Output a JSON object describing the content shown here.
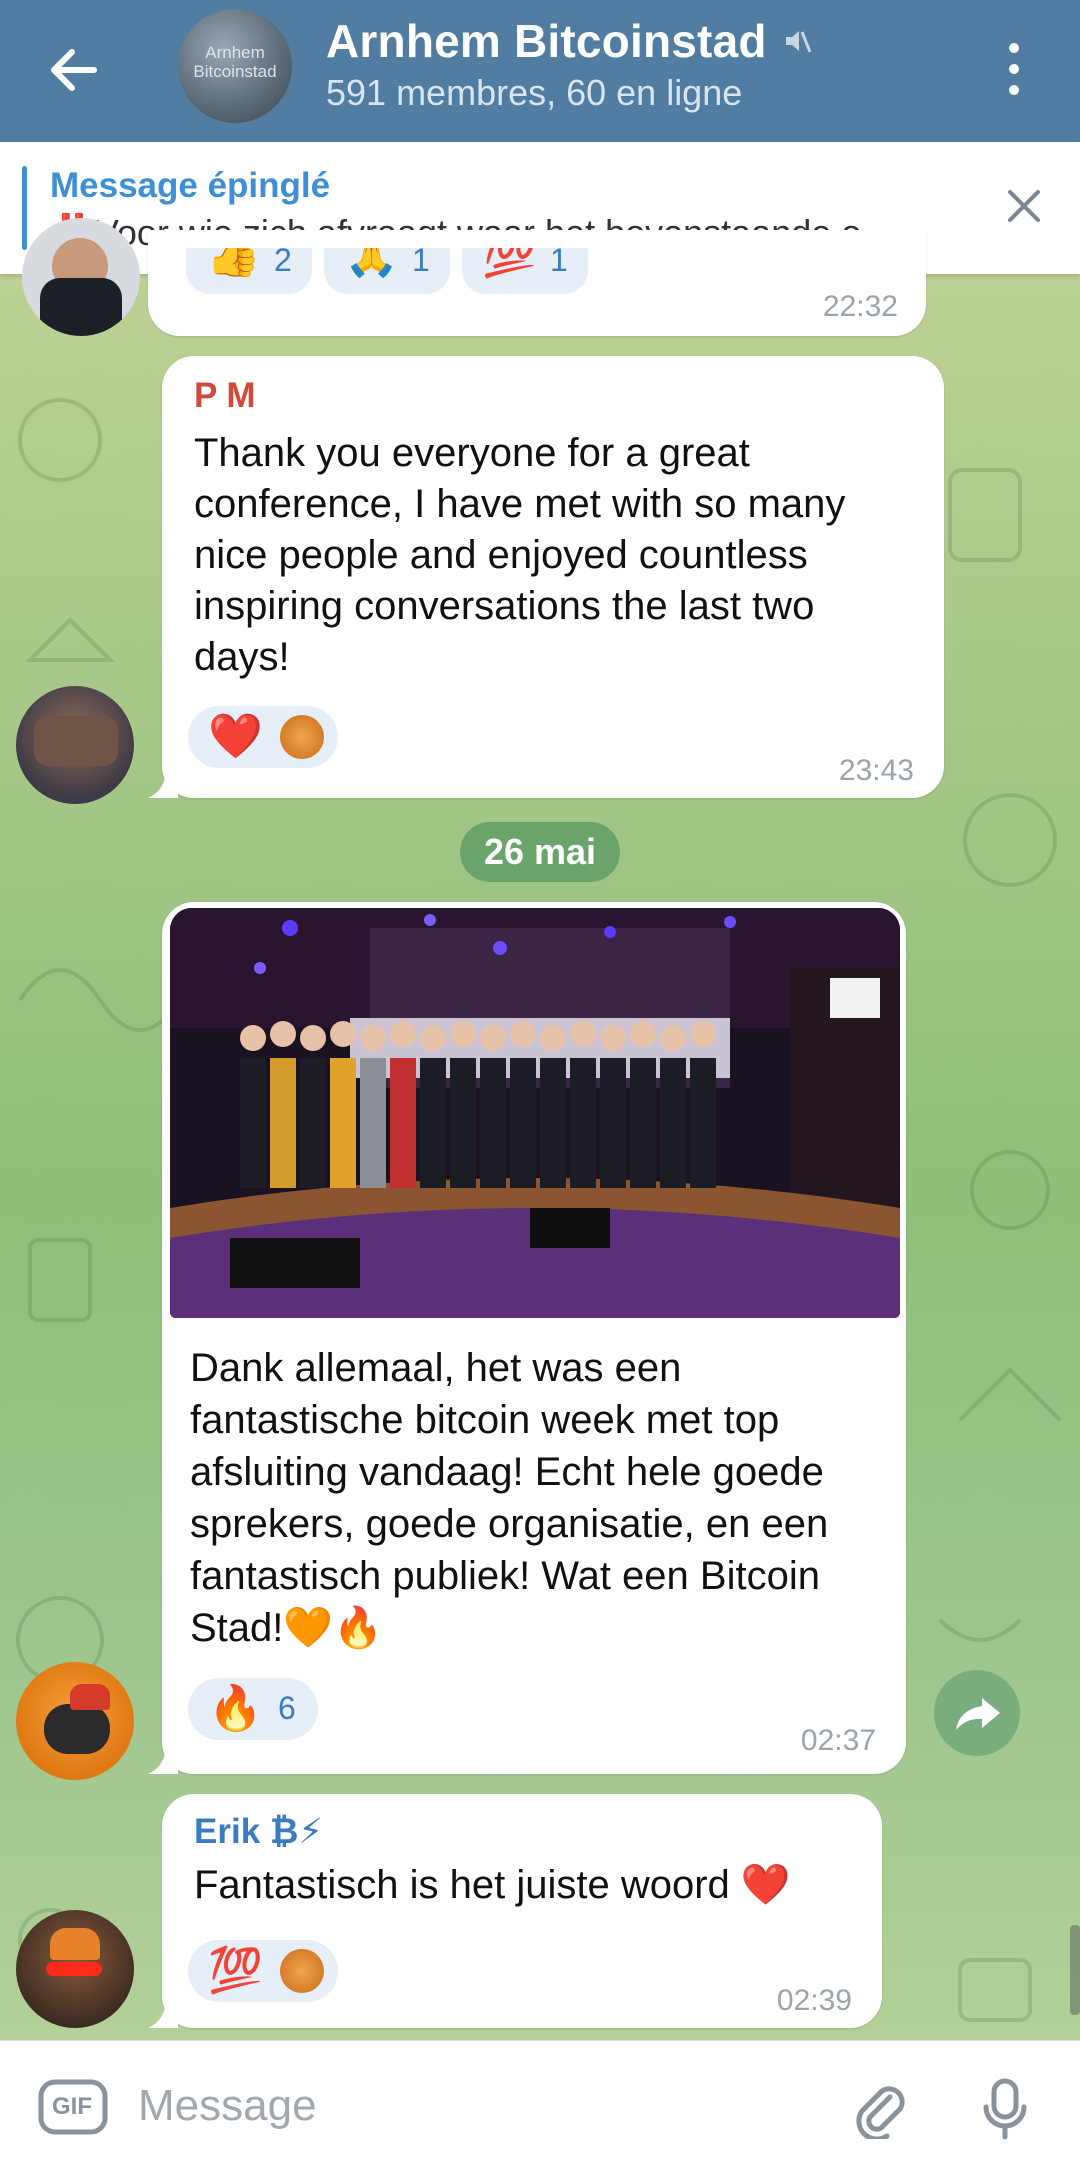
{
  "header": {
    "title": "Arnhem Bitcoinstad",
    "subtitle": "591 membres, 60 en ligne",
    "avatar_text": "Arnhem\nBitcoinstad"
  },
  "pinned": {
    "label": "Message épinglé",
    "prefix": "‼️",
    "text": "Voor wie zich afvraagt waar het bovenstaande o…"
  },
  "messages": [
    {
      "sender": "",
      "time": "22:32",
      "reactions": [
        {
          "emoji": "👍",
          "count": "2"
        },
        {
          "emoji": "🙏",
          "count": "1"
        },
        {
          "emoji": "💯",
          "count": "1"
        }
      ]
    },
    {
      "sender": "P M",
      "text": "Thank you everyone for a great conference, I have met with so many nice people and enjoyed countless inspiring conversations the last two days!",
      "time": "23:43",
      "reactions": [
        {
          "emoji": "❤️",
          "count": ""
        }
      ]
    },
    {
      "sender": "",
      "text": "Dank allemaal, het was een fantastische bitcoin week met top afsluiting vandaag! Echt hele goede sprekers, goede organisatie, en een fantastisch publiek! Wat een Bitcoin Stad!🧡🔥",
      "time": "02:37",
      "reactions": [
        {
          "emoji": "🔥",
          "count": "6"
        }
      ]
    },
    {
      "sender": "Erik ₿⚡",
      "text": "Fantastisch is het juiste woord ❤️",
      "time": "02:39",
      "reactions": [
        {
          "emoji": "💯",
          "count": ""
        }
      ]
    }
  ],
  "date_separator": "26 mai",
  "input": {
    "placeholder": "Message",
    "gif_label": "GIF"
  },
  "colors": {
    "header": "#517da2",
    "accent": "#3d8fd6",
    "sender_pm": "#d2493a",
    "sender_erik": "#3a7cc1"
  }
}
